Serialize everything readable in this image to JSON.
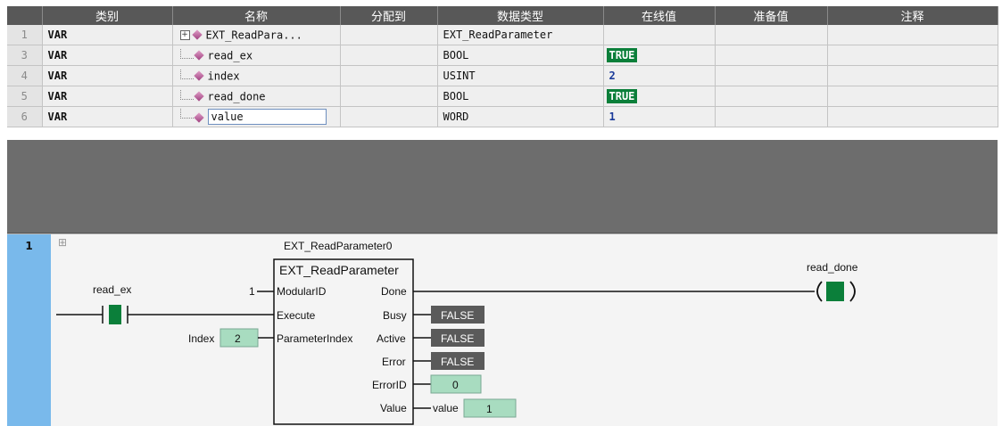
{
  "table": {
    "headers": [
      "类别",
      "名称",
      "分配到",
      "数据类型",
      "在线值",
      "准备值",
      "注释"
    ],
    "rows": [
      {
        "num": "1",
        "kind": "VAR",
        "name": "EXT_ReadPara...",
        "assign": "",
        "type": "EXT_ReadParameter",
        "online": "",
        "prepared": "",
        "comment": ""
      },
      {
        "num": "3",
        "kind": "VAR",
        "name": "read_ex",
        "assign": "",
        "type": "BOOL",
        "online": "TRUE",
        "prepared": "",
        "comment": ""
      },
      {
        "num": "4",
        "kind": "VAR",
        "name": "index",
        "assign": "",
        "type": "USINT",
        "online": "2",
        "prepared": "",
        "comment": ""
      },
      {
        "num": "5",
        "kind": "VAR",
        "name": "read_done",
        "assign": "",
        "type": "BOOL",
        "online": "TRUE",
        "prepared": "",
        "comment": ""
      },
      {
        "num": "6",
        "kind": "VAR",
        "name": "value",
        "assign": "",
        "type": "WORD",
        "online": "1",
        "prepared": "",
        "comment": ""
      }
    ],
    "expander_symbol": "+"
  },
  "rung": {
    "number": "1",
    "collapse_symbol": "⊞",
    "instance_name": "EXT_ReadParameter0",
    "fb_type": "EXT_ReadParameter",
    "contact_label": "read_ex",
    "coil_label": "read_done",
    "inputs": {
      "modular_id_const": "1",
      "modular_id": "ModularID",
      "execute": "Execute",
      "param_index_var": "Index",
      "param_index_val": "2",
      "param_index": "ParameterIndex"
    },
    "outputs": {
      "done": "Done",
      "busy": "Busy",
      "busy_val": "FALSE",
      "active": "Active",
      "active_val": "FALSE",
      "error": "Error",
      "error_val": "FALSE",
      "error_id": "ErrorID",
      "error_id_val": "0",
      "value": "Value",
      "value_var": "value",
      "value_val": "1"
    },
    "colors": {
      "bool_false_box": "#5a5a5a",
      "value_box": "#a8dcc0",
      "energized": "#0b7f3a",
      "gutter": "#79b9eb"
    }
  }
}
